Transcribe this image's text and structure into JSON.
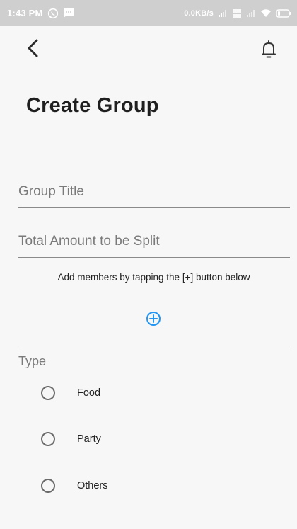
{
  "status_bar": {
    "time": "1:43 PM",
    "speed": "0.0KB/s",
    "icons": [
      "whatsapp-icon",
      "message-icon",
      "signal-icon",
      "volte-icon",
      "wifi-icon",
      "battery-icon"
    ]
  },
  "header": {
    "back_icon": "chevron-left-icon",
    "notification_icon": "bell-icon"
  },
  "title": "Create Group",
  "form": {
    "group_title_placeholder": "Group Title",
    "amount_placeholder": "Total Amount to be Split",
    "hint": "Add members by tapping the [+] button below",
    "add_icon": "plus-circle-icon",
    "accent_color": "#2196f3"
  },
  "type_section": {
    "label": "Type",
    "options": [
      "Food",
      "Party",
      "Others"
    ]
  }
}
